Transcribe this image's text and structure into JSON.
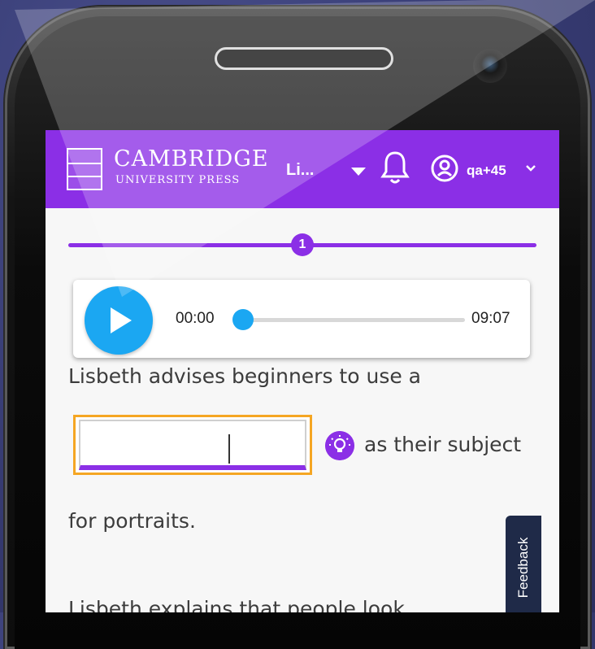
{
  "header": {
    "brand_title": "CAMBRIDGE",
    "brand_subtitle": "UNIVERSITY PRESS",
    "nav_title": "Li...",
    "user_label": "qa+45"
  },
  "stepper": {
    "current_step": "1"
  },
  "player": {
    "current_time": "00:00",
    "duration": "09:07",
    "progress": 0.0
  },
  "question": {
    "line1": "Lisbeth advises beginners to use a",
    "after_blank": "as their subject",
    "line3": "for portraits.",
    "line4": "Lisbeth explains that people look"
  },
  "feedback_tab": "Feedback",
  "colors": {
    "header": "#8b2fe6",
    "play": "#1ba7f2",
    "highlight": "#f5a623",
    "feedback_bg": "#1f2a48"
  },
  "icons": [
    "play-icon",
    "bell-icon",
    "user-icon",
    "chevron-down-icon",
    "lightbulb-icon",
    "caret-down-icon"
  ]
}
